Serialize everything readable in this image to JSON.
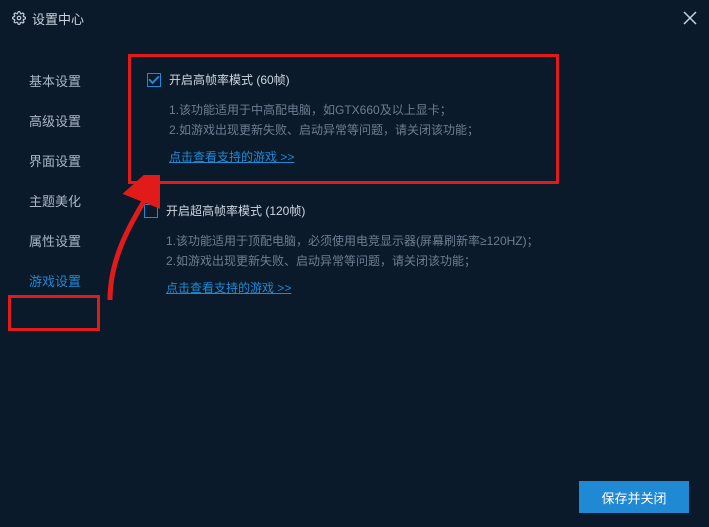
{
  "titlebar": {
    "title": "设置中心"
  },
  "sidebar": {
    "items": [
      {
        "label": "基本设置"
      },
      {
        "label": "高级设置"
      },
      {
        "label": "界面设置"
      },
      {
        "label": "主题美化"
      },
      {
        "label": "属性设置"
      },
      {
        "label": "游戏设置"
      }
    ],
    "activeIndex": 5
  },
  "sections": {
    "highFps": {
      "checkbox_checked": true,
      "title": "开启高帧率模式 (60帧)",
      "line1": "1.该功能适用于中高配电脑，如GTX660及以上显卡；",
      "line2": "2.如游戏出现更新失败、启动异常等问题，请关闭该功能；",
      "link": "点击查看支持的游戏 >>"
    },
    "ultraFps": {
      "checkbox_checked": false,
      "title": "开启超高帧率模式 (120帧)",
      "line1": "1.该功能适用于顶配电脑，必须使用电竞显示器(屏幕刷新率≥120HZ)；",
      "line2": "2.如游戏出现更新失败、启动异常等问题，请关闭该功能；",
      "link": "点击查看支持的游戏 >>"
    }
  },
  "footer": {
    "save_label": "保存并关闭"
  }
}
